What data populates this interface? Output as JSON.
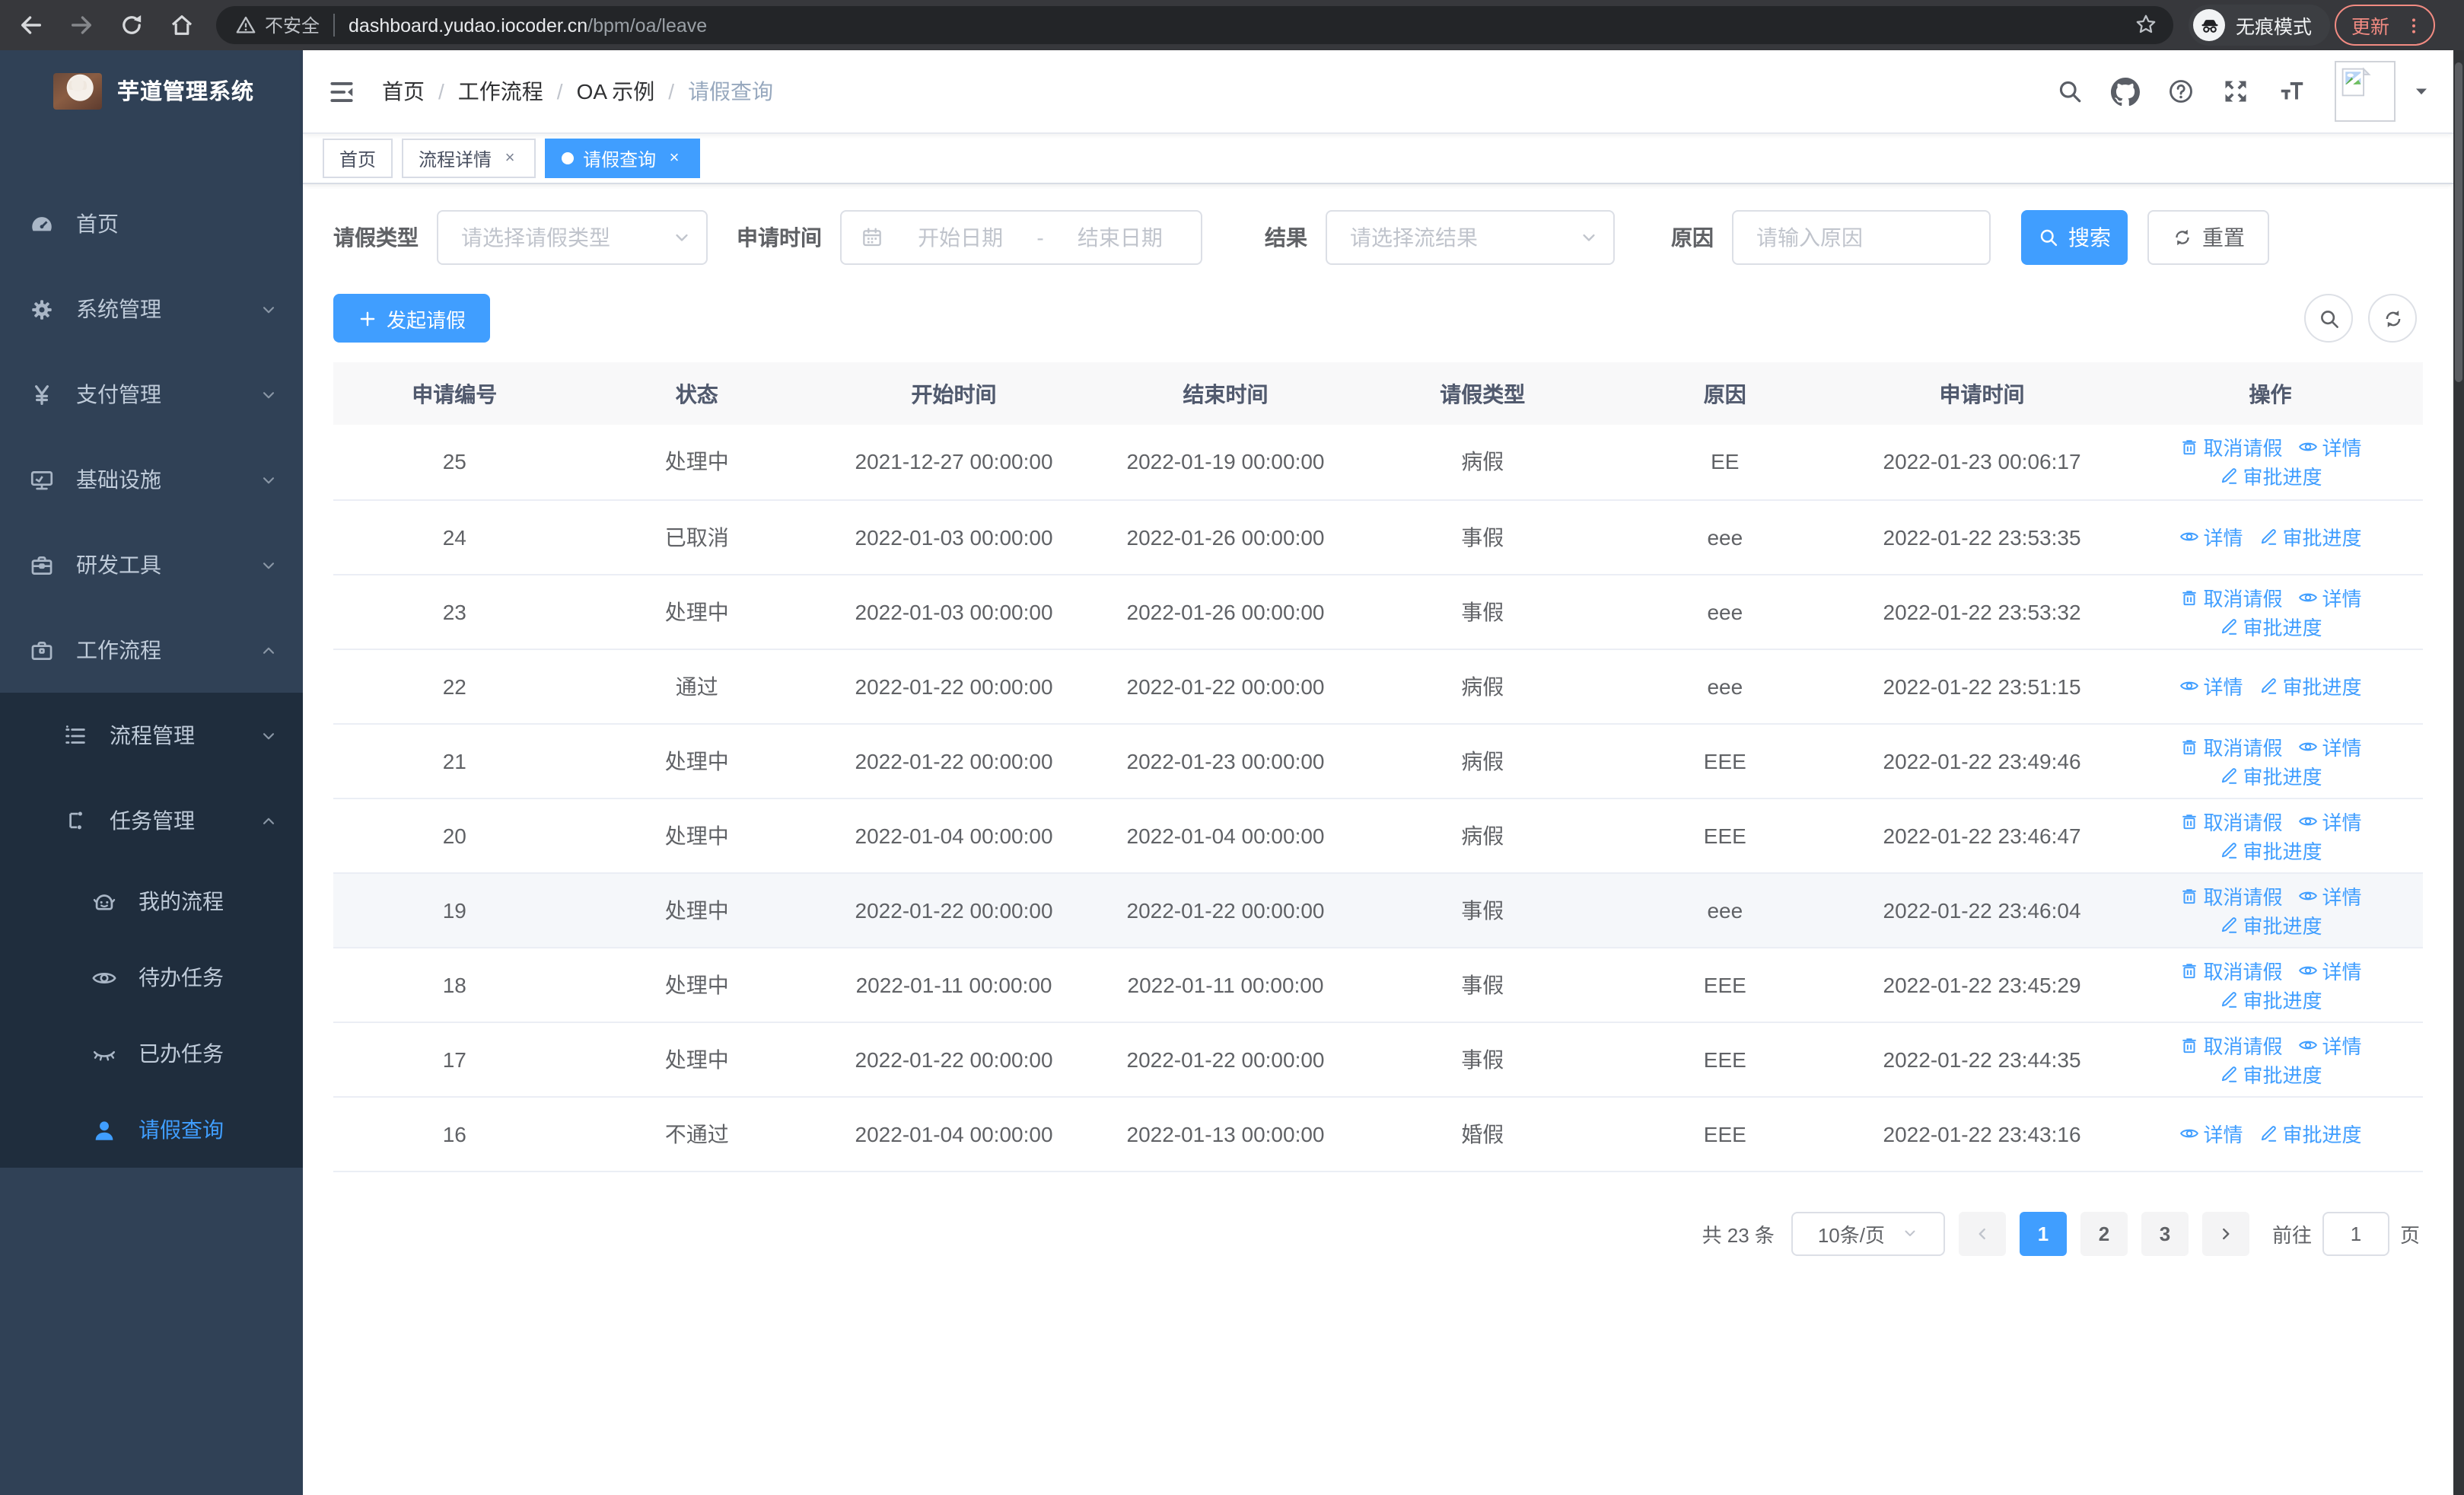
{
  "browser": {
    "security_label": "不安全",
    "url_host": "dashboard.yudao.iocoder.cn",
    "url_path": "/bpm/oa/leave",
    "incognito_label": "无痕模式",
    "update_label": "更新"
  },
  "sidebar": {
    "logo_title": "芋道管理系统",
    "menu": [
      {
        "label": "首页",
        "icon": "gauge",
        "level": 1,
        "chevron": null,
        "active": false
      },
      {
        "label": "系统管理",
        "icon": "gear",
        "level": 1,
        "chevron": "down",
        "active": false
      },
      {
        "label": "支付管理",
        "icon": "yen",
        "level": 1,
        "chevron": "down",
        "active": false
      },
      {
        "label": "基础设施",
        "icon": "monitor",
        "level": 1,
        "chevron": "down",
        "active": false
      },
      {
        "label": "研发工具",
        "icon": "toolbox",
        "level": 1,
        "chevron": "down",
        "active": false
      },
      {
        "label": "工作流程",
        "icon": "briefcase",
        "level": 1,
        "chevron": "up",
        "active": false
      },
      {
        "label": "流程管理",
        "icon": "list",
        "level": 2,
        "chevron": "down",
        "active": false
      },
      {
        "label": "任务管理",
        "icon": "flow",
        "level": 2,
        "chevron": "up",
        "active": false
      },
      {
        "label": "我的流程",
        "icon": "robot",
        "level": 3,
        "chevron": null,
        "active": false
      },
      {
        "label": "待办任务",
        "icon": "eye",
        "level": 3,
        "chevron": null,
        "active": false
      },
      {
        "label": "已办任务",
        "icon": "eye-closed",
        "level": 3,
        "chevron": null,
        "active": false
      },
      {
        "label": "请假查询",
        "icon": "user",
        "level": 3,
        "chevron": null,
        "active": true
      }
    ]
  },
  "header": {
    "breadcrumb": [
      "首页",
      "工作流程",
      "OA 示例",
      "请假查询"
    ],
    "separator": "/"
  },
  "tabs": [
    {
      "label": "首页",
      "closable": false,
      "active": false
    },
    {
      "label": "流程详情",
      "closable": true,
      "active": false
    },
    {
      "label": "请假查询",
      "closable": true,
      "active": true
    }
  ],
  "filters": {
    "leave_type_label": "请假类型",
    "leave_type_placeholder": "请选择请假类型",
    "apply_time_label": "申请时间",
    "date_start_placeholder": "开始日期",
    "date_separator": "-",
    "date_end_placeholder": "结束日期",
    "result_label": "结果",
    "result_placeholder": "请选择流结果",
    "reason_label": "原因",
    "reason_placeholder": "请输入原因",
    "search_label": "搜索",
    "reset_label": "重置"
  },
  "toolbar": {
    "create_label": "发起请假"
  },
  "table": {
    "columns": [
      "申请编号",
      "状态",
      "开始时间",
      "结束时间",
      "请假类型",
      "原因",
      "申请时间",
      "操作"
    ],
    "action_labels": {
      "cancel": "取消请假",
      "detail": "详情",
      "progress": "审批进度"
    },
    "rows": [
      {
        "id": "25",
        "status": "处理中",
        "start": "2021-12-27 00:00:00",
        "end": "2022-01-19 00:00:00",
        "type": "病假",
        "reason": "EE",
        "apply": "2022-01-23 00:06:17",
        "actions": [
          "cancel",
          "detail",
          "progress"
        ],
        "hover": false
      },
      {
        "id": "24",
        "status": "已取消",
        "start": "2022-01-03 00:00:00",
        "end": "2022-01-26 00:00:00",
        "type": "事假",
        "reason": "eee",
        "apply": "2022-01-22 23:53:35",
        "actions": [
          "detail",
          "progress"
        ],
        "hover": false
      },
      {
        "id": "23",
        "status": "处理中",
        "start": "2022-01-03 00:00:00",
        "end": "2022-01-26 00:00:00",
        "type": "事假",
        "reason": "eee",
        "apply": "2022-01-22 23:53:32",
        "actions": [
          "cancel",
          "detail",
          "progress"
        ],
        "hover": false
      },
      {
        "id": "22",
        "status": "通过",
        "start": "2022-01-22 00:00:00",
        "end": "2022-01-22 00:00:00",
        "type": "病假",
        "reason": "eee",
        "apply": "2022-01-22 23:51:15",
        "actions": [
          "detail",
          "progress"
        ],
        "hover": false
      },
      {
        "id": "21",
        "status": "处理中",
        "start": "2022-01-22 00:00:00",
        "end": "2022-01-23 00:00:00",
        "type": "病假",
        "reason": "EEE",
        "apply": "2022-01-22 23:49:46",
        "actions": [
          "cancel",
          "detail",
          "progress"
        ],
        "hover": false
      },
      {
        "id": "20",
        "status": "处理中",
        "start": "2022-01-04 00:00:00",
        "end": "2022-01-04 00:00:00",
        "type": "病假",
        "reason": "EEE",
        "apply": "2022-01-22 23:46:47",
        "actions": [
          "cancel",
          "detail",
          "progress"
        ],
        "hover": false
      },
      {
        "id": "19",
        "status": "处理中",
        "start": "2022-01-22 00:00:00",
        "end": "2022-01-22 00:00:00",
        "type": "事假",
        "reason": "eee",
        "apply": "2022-01-22 23:46:04",
        "actions": [
          "cancel",
          "detail",
          "progress"
        ],
        "hover": true
      },
      {
        "id": "18",
        "status": "处理中",
        "start": "2022-01-11 00:00:00",
        "end": "2022-01-11 00:00:00",
        "type": "事假",
        "reason": "EEE",
        "apply": "2022-01-22 23:45:29",
        "actions": [
          "cancel",
          "detail",
          "progress"
        ],
        "hover": false
      },
      {
        "id": "17",
        "status": "处理中",
        "start": "2022-01-22 00:00:00",
        "end": "2022-01-22 00:00:00",
        "type": "事假",
        "reason": "EEE",
        "apply": "2022-01-22 23:44:35",
        "actions": [
          "cancel",
          "detail",
          "progress"
        ],
        "hover": false
      },
      {
        "id": "16",
        "status": "不通过",
        "start": "2022-01-04 00:00:00",
        "end": "2022-01-13 00:00:00",
        "type": "婚假",
        "reason": "EEE",
        "apply": "2022-01-22 23:43:16",
        "actions": [
          "detail",
          "progress"
        ],
        "hover": false
      }
    ]
  },
  "pagination": {
    "total_label": "共 23 条",
    "page_size_label": "10条/页",
    "pages": [
      "1",
      "2",
      "3"
    ],
    "active_page": "1",
    "goto_label": "前往",
    "goto_value": "1",
    "goto_suffix": "页"
  },
  "colors": {
    "accent": "#409eff",
    "sidebar_bg": "#304156",
    "submenu_bg": "#1f2d3d"
  }
}
